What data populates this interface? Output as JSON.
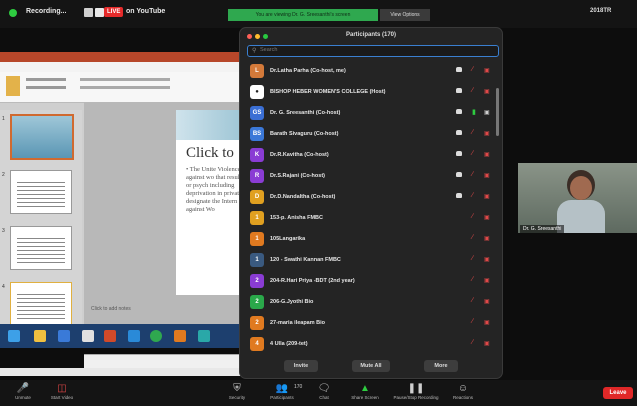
{
  "top_bar": {
    "recording_label": "Recording...",
    "live_badge": "LIVE",
    "live_label": "on YouTube",
    "viewing_banner": "You are viewing Dr. G. Sreesanthi's screen",
    "view_options": "View Options",
    "top_right": "2018TR"
  },
  "powerpoint": {
    "slide_title": "Click to",
    "slide_body": "• The Unite Violence against wo that result or psych including deprivation in private designate the Intern against Wo",
    "notes_placeholder": "Click to add notes",
    "thumbnail_numbers": [
      "1",
      "2",
      "3",
      "4"
    ]
  },
  "participants_panel": {
    "title": "Participants (170)",
    "search_placeholder": "Search",
    "participants": [
      {
        "name": "Dr.Latha Parha (Co-host, me)",
        "color": "#d47a3a",
        "initial": "L",
        "hand": true,
        "mic_muted": true,
        "cam_off": true
      },
      {
        "name": "BISHOP HEBER WOMEN'S COLLEGE (Host)",
        "color": "#ffffff",
        "initial": "●",
        "hand": true,
        "mic_muted": true,
        "cam_off": true
      },
      {
        "name": "Dr. G. Sreesanthi (Co-host)",
        "color": "#3b6fd4",
        "initial": "GS",
        "hand": true,
        "mic_muted": false,
        "cam_off": false
      },
      {
        "name": "Barath Sivaguru (Co-host)",
        "color": "#3b78d8",
        "initial": "BS",
        "hand": true,
        "mic_muted": true,
        "cam_off": true
      },
      {
        "name": "Dr.R.Kavitha (Co-host)",
        "color": "#8a3cd4",
        "initial": "K",
        "hand": true,
        "mic_muted": true,
        "cam_off": true
      },
      {
        "name": "Dr.S.Rajani (Co-host)",
        "color": "#8a3cd4",
        "initial": "R",
        "hand": true,
        "mic_muted": true,
        "cam_off": true
      },
      {
        "name": "Dr.D.Nandaltha (Co-host)",
        "color": "#e0a020",
        "initial": "D",
        "hand": true,
        "mic_muted": true,
        "cam_off": true
      },
      {
        "name": "153-p. Anisha FMBC",
        "color": "#e0a020",
        "initial": "1",
        "hand": false,
        "mic_muted": true,
        "cam_off": true
      },
      {
        "name": "105Langarika",
        "color": "#e07a20",
        "initial": "1",
        "hand": false,
        "mic_muted": true,
        "cam_off": true
      },
      {
        "name": "120 - Swathi Kannan FMBC",
        "color": "#3a5a80",
        "initial": "1",
        "hand": false,
        "mic_muted": true,
        "cam_off": true
      },
      {
        "name": "204-R.Hari Priya -BDT (2nd year)",
        "color": "#8a3cd4",
        "initial": "2",
        "hand": false,
        "mic_muted": true,
        "cam_off": true
      },
      {
        "name": "206-G.Jyothi Bio",
        "color": "#2aa84a",
        "initial": "2",
        "hand": false,
        "mic_muted": true,
        "cam_off": true
      },
      {
        "name": "27-maria ileapam Bio",
        "color": "#e07a20",
        "initial": "2",
        "hand": false,
        "mic_muted": true,
        "cam_off": true
      },
      {
        "name": "4 Ulla (209-tet)",
        "color": "#e07a20",
        "initial": "4",
        "hand": false,
        "mic_muted": true,
        "cam_off": true
      }
    ],
    "invite_label": "Invite",
    "mute_all_label": "Mute All",
    "more_label": "More"
  },
  "video_tile": {
    "name": "Dr. G. Sreesanthi"
  },
  "bottom_toolbar": {
    "items": [
      {
        "label": "Unmute",
        "icon": "microphone-icon"
      },
      {
        "label": "Start Video",
        "icon": "video-icon"
      },
      {
        "label": "Security",
        "icon": "shield-icon"
      },
      {
        "label": "Participants",
        "icon": "participants-icon",
        "count": "170"
      },
      {
        "label": "Chat",
        "icon": "chat-icon"
      },
      {
        "label": "Share Screen",
        "icon": "share-screen-icon"
      },
      {
        "label": "Pause/Stop Recording",
        "icon": "record-icon"
      },
      {
        "label": "Reactions",
        "icon": "reactions-icon"
      }
    ],
    "leave_label": "Leave",
    "participant_count": "170"
  }
}
